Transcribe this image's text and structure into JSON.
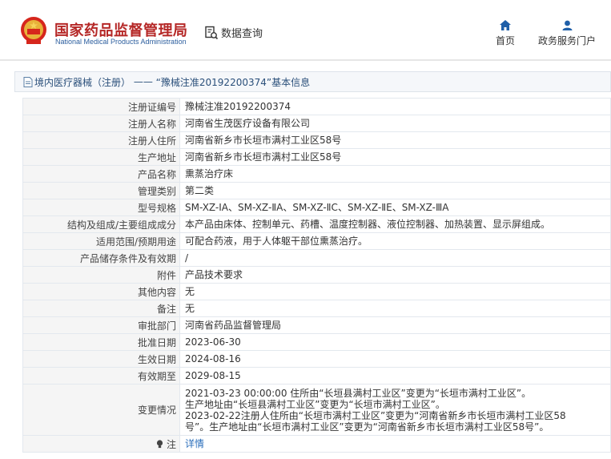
{
  "site": {
    "name_cn": "国家药品监督管理局",
    "name_en": "National Medical Products Administration",
    "query_label": "数据查询"
  },
  "nav": {
    "home": "首页",
    "gov_portal": "政务服务门户"
  },
  "breadcrumb": {
    "category": "境内医疗器械（注册）",
    "separator": "——",
    "title": "“豫械注准20192200374”基本信息"
  },
  "record": [
    {
      "key": "注册证编号",
      "value": "豫械注准20192200374"
    },
    {
      "key": "注册人名称",
      "value": "河南省生茂医疗设备有限公司"
    },
    {
      "key": "注册人住所",
      "value": "河南省新乡市长垣市满村工业区58号"
    },
    {
      "key": "生产地址",
      "value": "河南省新乡市长垣市满村工业区58号"
    },
    {
      "key": "产品名称",
      "value": "熏蒸治疗床"
    },
    {
      "key": "管理类别",
      "value": "第二类"
    },
    {
      "key": "型号规格",
      "value": "SM-XZ-ⅠA、SM-XZ-ⅡA、SM-XZ-ⅡC、SM-XZ-ⅡE、SM-XZ-ⅢA"
    },
    {
      "key": "结构及组成/主要组成成分",
      "value": "本产品由床体、控制单元、药槽、温度控制器、液位控制器、加热装置、显示屏组成。"
    },
    {
      "key": "适用范围/预期用途",
      "value": "可配合药液，用于人体躯干部位熏蒸治疗。"
    },
    {
      "key": "产品储存条件及有效期",
      "value": "/"
    },
    {
      "key": "附件",
      "value": "产品技术要求"
    },
    {
      "key": "其他内容",
      "value": "无"
    },
    {
      "key": "备注",
      "value": "无"
    },
    {
      "key": "审批部门",
      "value": "河南省药品监督管理局"
    },
    {
      "key": "批准日期",
      "value": "2023-06-30"
    },
    {
      "key": "生效日期",
      "value": "2024-08-16"
    },
    {
      "key": "有效期至",
      "value": "2029-08-15"
    }
  ],
  "changes": {
    "key": "变更情况",
    "lines": [
      "2021-03-23 00:00:00 住所由“长垣县满村工业区”变更为“长垣市满村工业区”。",
      "生产地址由“长垣县满村工业区”变更为“长垣市满村工业区”。",
      "2023-02-22注册人住所由“长垣市满村工业区”变更为“河南省新乡市长垣市满村工业区58",
      "号”。生产地址由“长垣市满村工业区”变更为“河南省新乡市长垣市满村工业区58号”。"
    ]
  },
  "note": {
    "key": "注",
    "link": "详情"
  },
  "colors": {
    "brand_red": "#b52726",
    "brand_blue": "#2c5e9e",
    "nav_icon_blue": "#1f5fa8",
    "link_blue": "#2a6ebb"
  },
  "icons": [
    "national-emblem-icon",
    "search-document-icon",
    "home-icon",
    "user-icon",
    "document-icon",
    "lightbulb-icon"
  ]
}
